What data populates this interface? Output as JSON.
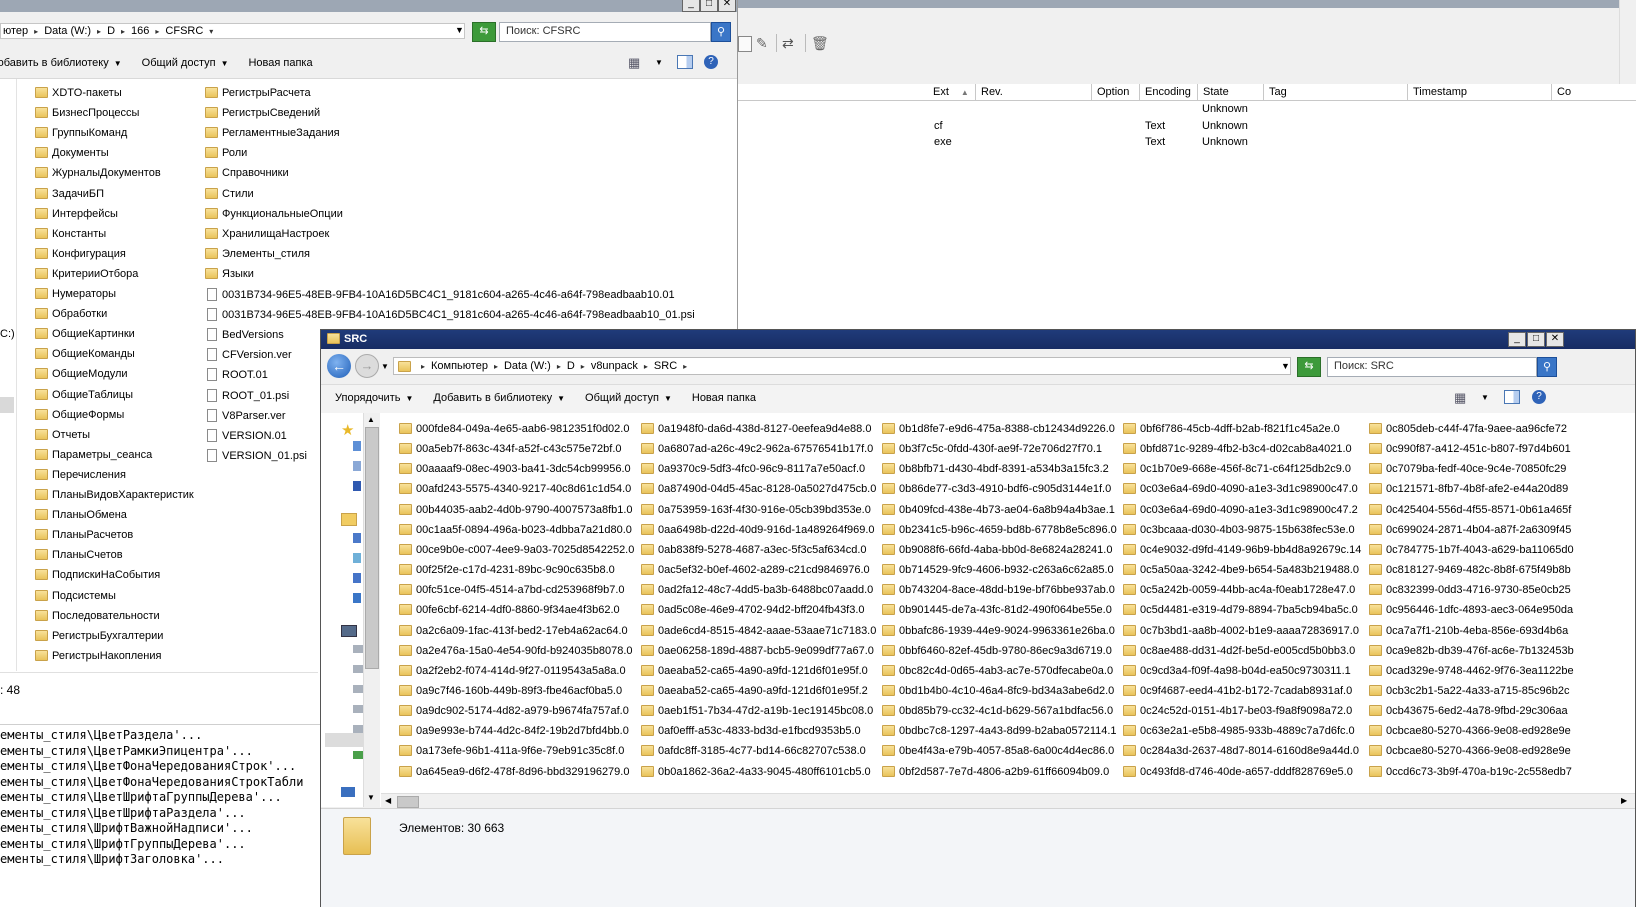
{
  "cfsrc_window": {
    "address": [
      "ютер",
      "Data (W:)",
      "D",
      "166",
      "CFSRC"
    ],
    "search_placeholder": "Поиск: CFSRC",
    "toolbar": {
      "add_library": "Добавить в библиотеку",
      "share": "Общий доступ",
      "new_folder": "Новая папка"
    },
    "sidebar_fragments": [
      "C:)"
    ],
    "col1": [
      "XDTO-пакеты",
      "БизнесПроцессы",
      "ГруппыКоманд",
      "Документы",
      "ЖурналыДокументов",
      "ЗадачиБП",
      "Интерфейсы",
      "Константы",
      "Конфигурация",
      "КритерииОтбора",
      "Нумераторы",
      "Обработки",
      "ОбщиеКартинки",
      "ОбщиеКоманды",
      "ОбщиеМодули",
      "ОбщиеТаблицы",
      "ОбщиеФормы",
      "Отчеты",
      "Параметры_сеанса",
      "Перечисления",
      "ПланыВидовХарактеристик",
      "ПланыОбмена",
      "ПланыРасчетов",
      "ПланыСчетов",
      "ПодпискиНаСобытия",
      "Подсистемы",
      "Последовательности",
      "РегистрыБухгалтерии",
      "РегистрыНакопления"
    ],
    "col2_folders": [
      "РегистрыРасчета",
      "РегистрыСведений",
      "РегламентныеЗадания",
      "Роли",
      "Справочники",
      "Стили",
      "ФункциональныеОпции",
      "ХранилищаНастроек",
      "Элементы_стиля",
      "Языки"
    ],
    "col2_files": [
      "0031B734-96E5-48EB-9FB4-10A16D5BC4C1_9181c604-a265-4c46-a64f-798eadbaab10.01",
      "0031B734-96E5-48EB-9FB4-10A16D5BC4C1_9181c604-a265-4c46-a64f-798eadbaab10_01.psi",
      "BedVersions",
      "CFVersion.ver",
      "ROOT.01",
      "ROOT_01.psi",
      "V8Parser.ver",
      "VERSION.01",
      "VERSION_01.psi"
    ],
    "status_count": ": 48"
  },
  "log_lines": [
    "ементы_стиля\\ЦветРаздела'...",
    "ементы_стиля\\ЦветРамкиЭпицентра'...",
    "ементы_стиля\\ЦветФонаЧередованияСтрок'...",
    "ементы_стиля\\ЦветФонаЧередованияСтрокТабли",
    "ементы_стиля\\ЦветШрифтаГруппыДерева'...",
    "ементы_стиля\\ЦветШрифтаРаздела'...",
    "ементы_стиля\\ШрифтВажнойНадписи'...",
    "ементы_стиля\\ШрифтГруппыДерева'...",
    "ементы_стиля\\ШрифтЗаголовка'..."
  ],
  "vcs_window": {
    "columns": [
      "Ext",
      "Rev.",
      "Option",
      "Encoding",
      "State",
      "Tag",
      "Timestamp",
      "Co"
    ],
    "rows": [
      {
        "ext": "",
        "encoding": "",
        "state": "Unknown"
      },
      {
        "ext": "cf",
        "encoding": "Text",
        "state": "Unknown"
      },
      {
        "ext": "exe",
        "encoding": "Text",
        "state": "Unknown"
      }
    ]
  },
  "src_window": {
    "title": "SRC",
    "address": [
      "Компьютер",
      "Data (W:)",
      "D",
      "v8unpack",
      "SRC"
    ],
    "search_placeholder": "Поиск: SRC",
    "toolbar": {
      "organize": "Упорядочить",
      "add_library": "Добавить в библиотеку",
      "share": "Общий доступ",
      "new_folder": "Новая папка"
    },
    "columns": [
      [
        "000fde84-049a-4e65-aab6-9812351f0d02.0",
        "00a5eb7f-863c-434f-a52f-c43c575e72bf.0",
        "00aaaaf9-08ec-4903-ba41-3dc54cb99956.0",
        "00afd243-5575-4340-9217-40c8d61c1d54.0",
        "00b44035-aab2-4d0b-9790-4007573a8fb1.0",
        "00c1aa5f-0894-496a-b023-4dbba7a21d80.0",
        "00ce9b0e-c007-4ee9-9a03-7025d8542252.0",
        "00f25f2e-c17d-4231-89bc-9c90c635b8.0",
        "00fc51ce-04f5-4514-a7bd-cd253968f9b7.0",
        "00fe6cbf-6214-4df0-8860-9f34ae4f3b62.0",
        "0a2c6a09-1fac-413f-bed2-17eb4a62ac64.0",
        "0a2e476a-15a0-4e54-90fd-b924035b8078.0",
        "0a2f2eb2-f074-414d-9f27-0119543a5a8a.0",
        "0a9c7f46-160b-449b-89f3-fbe46acf0ba5.0",
        "0a9dc902-5174-4d82-a979-b9674fa757af.0",
        "0a9e993e-b744-4d2c-84f2-19b2d7bfd4bb.0",
        "0a173efe-96b1-411a-9f6e-79eb91c35c8f.0",
        "0a645ea9-d6f2-478f-8d96-bbd329196279.0"
      ],
      [
        "0a1948f0-da6d-438d-8127-0eefea9d4e88.0",
        "0a6807ad-a26c-49c2-962a-67576541b17f.0",
        "0a9370c9-5df3-4fc0-96c9-8117a7e50acf.0",
        "0a87490d-04d5-45ac-8128-0a5027d475cb.0",
        "0a753959-163f-4f30-916e-05cb39bd353e.0",
        "0aa6498b-d22d-40d9-916d-1a489264f969.0",
        "0ab838f9-5278-4687-a3ec-5f3c5af634cd.0",
        "0ac5ef32-b0ef-4602-a289-c21cd9846976.0",
        "0ad2fa12-48c7-4dd5-ba3b-6488bc07aadd.0",
        "0ad5c08e-46e9-4702-94d2-bff204fb43f3.0",
        "0ade6cd4-8515-4842-aaae-53aae71c7183.0",
        "0ae06258-189d-4887-bcb5-9e099df77a67.0",
        "0aeaba52-ca65-4a90-a9fd-121d6f01e95f.0",
        "0aeaba52-ca65-4a90-a9fd-121d6f01e95f.2",
        "0aeb1f51-7b34-47d2-a19b-1ec19145bc08.0",
        "0af0efff-a53c-4833-bd3d-e1fbcd9353b5.0",
        "0afdc8ff-3185-4c77-bd14-66c82707c538.0",
        "0b0a1862-36a2-4a33-9045-480ff6101cb5.0"
      ],
      [
        "0b1d8fe7-e9d6-475a-8388-cb12434d9226.0",
        "0b3f7c5c-0fdd-430f-ae9f-72e706d27f70.1",
        "0b8bfb71-d430-4bdf-8391-a534b3a15fc3.2",
        "0b86de77-c3d3-4910-bdf6-c905d3144e1f.0",
        "0b409fcd-438e-4b73-ae04-6a8b94a4b3ae.1",
        "0b2341c5-b96c-4659-bd8b-6778b8e5c896.0",
        "0b9088f6-66fd-4aba-bb0d-8e6824a28241.0",
        "0b714529-9fc9-4606-b932-c263a6c62a85.0",
        "0b743204-8ace-48dd-b19e-bf76bbe937ab.0",
        "0b901445-de7a-43fc-81d2-490f064be55e.0",
        "0bbafc86-1939-44e9-9024-9963361e26ba.0",
        "0bbf6460-82ef-45db-9780-86ec9a3d6719.0",
        "0bc82c4d-0d65-4ab3-ac7e-570dfecabe0a.0",
        "0bd1b4b0-4c10-46a4-8fc9-bd34a3abe6d2.0",
        "0bd85b79-cc32-4c1d-b629-567a1bdfac56.0",
        "0bdbc7c8-1297-4a43-8d99-b2aba0572114.1",
        "0be4f43a-e79b-4057-85a8-6a00c4d4ec86.0",
        "0bf2d587-7e7d-4806-a2b9-61ff66094b09.0"
      ],
      [
        "0bf6f786-45cb-4dff-b2ab-f821f1c45a2e.0",
        "0bfd871c-9289-4fb2-b3c4-d02cab8a4021.0",
        "0c1b70e9-668e-456f-8c71-c64f125db2c9.0",
        "0c03e6a4-69d0-4090-a1e3-3d1c98900c47.0",
        "0c03e6a4-69d0-4090-a1e3-3d1c98900c47.2",
        "0c3bcaaa-d030-4b03-9875-15b638fec53e.0",
        "0c4e9032-d9fd-4149-96b9-bb4d8a92679c.14",
        "0c5a50aa-3242-4be9-b654-5a483b219488.0",
        "0c5a242b-0059-44bb-ac4a-f0eab1728e47.0",
        "0c5d4481-e319-4d79-8894-7ba5cb94ba5c.0",
        "0c7b3bd1-aa8b-4002-b1e9-aaaa72836917.0",
        "0c8ae488-dd31-4d2f-be5d-e005cd5b0bb3.0",
        "0c9cd3a4-f09f-4a98-b04d-ea50c9730311.1",
        "0c9f4687-eed4-41b2-b172-7cadab8931af.0",
        "0c24c52d-0151-4b17-be03-f9a8f9098a72.0",
        "0c63e2a1-e5b8-4985-933b-4889c7a7d6fc.0",
        "0c284a3d-2637-48d7-8014-6160d8e9a44d.0",
        "0c493fd8-d746-40de-a657-dddf828769e5.0"
      ],
      [
        "0c805deb-c44f-47fa-9aee-aa96cfe72",
        "0c990f87-a412-451c-b807-f97d4b601",
        "0c7079ba-fedf-40ce-9c4e-70850fc29",
        "0c121571-8fb7-4b8f-afe2-e44a20d89",
        "0c425404-556d-4f55-8571-0b61a465f",
        "0c699024-2871-4b04-a87f-2a6309f45",
        "0c784775-1b7f-4043-a629-ba11065d0",
        "0c818127-9469-482c-8b8f-675f49b8b",
        "0c832399-0dd3-4716-9730-85e0cb25",
        "0c956446-1dfc-4893-aec3-064e950da",
        "0ca7a7f1-210b-4eba-856e-693d4b6a",
        "0ca9e82b-db39-476f-ac6e-7b132453b",
        "0cad329e-9748-4462-9f76-3ea1122be",
        "0cb3c2b1-5a22-4a33-a715-85c96b2c",
        "0cb43675-6ed2-4a78-9fbd-29c306aa",
        "0cbcae80-5270-4366-9e08-ed928e9e",
        "0cbcae80-5270-4366-9e08-ed928e9e",
        "0ccd6c73-3b9f-470a-b19c-2c558edb7"
      ]
    ],
    "status": "Элементов: 30 663"
  }
}
